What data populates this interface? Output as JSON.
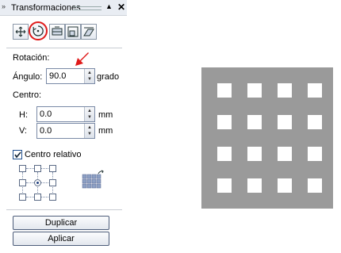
{
  "panel": {
    "title": "Transformaciones",
    "tools": [
      {
        "name": "position-tool-icon"
      },
      {
        "name": "rotate-tool-icon",
        "active": true
      },
      {
        "name": "mirror-tool-icon"
      },
      {
        "name": "size-tool-icon"
      },
      {
        "name": "skew-tool-icon"
      }
    ],
    "rotation_label": "Rotación:",
    "angle_label": "Ángulo:",
    "angle_value": "90.0",
    "angle_unit": "grado",
    "center_label": "Centro:",
    "h_label": "H:",
    "h_value": "0.0",
    "h_unit": "mm",
    "v_label": "V:",
    "v_value": "0.0",
    "v_unit": "mm",
    "relative_center_label": "Centro relativo",
    "relative_center_checked": true,
    "duplicate_label": "Duplicar",
    "apply_label": "Aplicar"
  },
  "colors": {
    "highlight_red": "#e01a1a",
    "preview_gray": "#9a9a9a"
  }
}
